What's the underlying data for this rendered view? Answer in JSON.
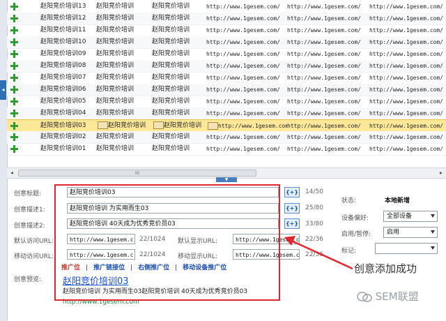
{
  "grid": {
    "rows": [
      {
        "name": "赵阳竞价培训13",
        "c2": "赵阳竞价培训",
        "c3": "赵阳竞价培训",
        "u1": "http://www.1gesem.com/",
        "u2": "http://www.1gesem.com/",
        "u3": "http://www.1gesem.com/"
      },
      {
        "name": "赵阳竞价培训12",
        "c2": "赵阳竞价培训",
        "c3": "赵阳竞价培训",
        "u1": "http://www.1gesem.com/",
        "u2": "http://www.1gesem.com/",
        "u3": "http://www.1gesem.com/"
      },
      {
        "name": "赵阳竞价培训11",
        "c2": "赵阳竞价培训",
        "c3": "赵阳竞价培训",
        "u1": "http://www.1gesem.com/",
        "u2": "http://www.1gesem.com/",
        "u3": "http://www.1gesem.com/"
      },
      {
        "name": "赵阳竞价培训10",
        "c2": "赵阳竞价培训",
        "c3": "赵阳竞价培训",
        "u1": "http://www.1gesem.com/",
        "u2": "http://www.1gesem.com/",
        "u3": "http://www.1gesem.com/"
      },
      {
        "name": "赵阳竞价培训09",
        "c2": "赵阳竞价培训",
        "c3": "赵阳竞价培训",
        "u1": "http://www.1gesem.com/",
        "u2": "http://www.1gesem.com/",
        "u3": "http://www.1gesem.com/"
      },
      {
        "name": "赵阳竞价培训08",
        "c2": "赵阳竞价培训",
        "c3": "赵阳竞价培训",
        "u1": "http://www.1gesem.com/",
        "u2": "http://www.1gesem.com/",
        "u3": "http://www.1gesem.com/"
      },
      {
        "name": "赵阳竞价培训07",
        "c2": "赵阳竞价培训",
        "c3": "赵阳竞价培训",
        "u1": "http://www.1gesem.com/",
        "u2": "http://www.1gesem.com/",
        "u3": "http://www.1gesem.com/"
      },
      {
        "name": "赵阳竞价培训06",
        "c2": "赵阳竞价培训",
        "c3": "赵阳竞价培训",
        "u1": "http://www.1gesem.com/",
        "u2": "http://www.1gesem.com/",
        "u3": "http://www.1gesem.com/"
      },
      {
        "name": "赵阳竞价培训05",
        "c2": "赵阳竞价培训",
        "c3": "赵阳竞价培训",
        "u1": "http://www.1gesem.com/",
        "u2": "http://www.1gesem.com/",
        "u3": "http://www.1gesem.com/"
      },
      {
        "name": "赵阳竞价培训04",
        "c2": "赵阳竞价培训",
        "c3": "赵阳竞价培训",
        "u1": "http://www.1gesem.com/",
        "u2": "http://www.1gesem.com/",
        "u3": "http://www.1gesem.com/"
      },
      {
        "name": "赵阳竞价培训03",
        "c2": "赵阳竞价培训",
        "c3": "赵阳竞价培训",
        "u1": "http://www.1gesem.com/",
        "u2": "http://www.1gesem.com/",
        "u3": "http://www.1gesem.com/"
      },
      {
        "name": "赵阳竞价培训02",
        "c2": "赵阳竞价培训",
        "c3": "赵阳竞价培训",
        "u1": "http://www.1gesem.com/",
        "u2": "http://www.1gesem.com/",
        "u3": "http://www.1gesem.com/"
      },
      {
        "name": "赵阳竞价培训01",
        "c2": "赵阳竞价培训",
        "c3": "赵阳竞价培训",
        "u1": "http://www.1gesem.com/",
        "u2": "http://www.1gesem.com/",
        "u3": "http://www.1gesem.com/"
      }
    ],
    "selected_index": 10,
    "scroll_thumb_label": "III"
  },
  "editor": {
    "title_label": "创意标题:",
    "title_value": "赵阳竞价培训03",
    "title_count": "14/50",
    "desc1_label": "创意描述1:",
    "desc1_value": "赵阳竞价培训 为实用而生03",
    "desc1_count": "25/80",
    "desc2_label": "创意描述2:",
    "desc2_value": "赵阳竞价培训 40天成为优秀竞价员03",
    "desc2_count": "33/80",
    "insert_label": "{+}",
    "pc_url_label": "默认访问URL:",
    "pc_url_value": "http://www.1gesem.c",
    "pc_url_count": "22/1024",
    "pc_display_label": "默认显示URL:",
    "pc_display_value": "http://www.1gesem.c",
    "pc_display_count": "22/36",
    "mobile_url_label": "移动访问URL:",
    "mobile_url_value": "http://www.1gesem.c",
    "mobile_url_count": "22/1024",
    "mobile_display_label": "移动显示URL:",
    "mobile_display_value": "http://www.1gesem.c",
    "mobile_display_count": "22/36",
    "tabs": [
      "推广位",
      "推广链接位",
      "右侧推广位",
      "移动设备推广位"
    ],
    "preview_label": "创意预览:",
    "preview_title": "赵阳竞价培训03",
    "preview_desc": "赵阳竞价培训 为实用而生03赵阳竞价培训 40天成为优秀竞价员03",
    "preview_url": "http://www.1gesem.com"
  },
  "side": {
    "status_label": "状态:",
    "status_value": "本地新增",
    "device_label": "设备偏好:",
    "device_value": "全部设备",
    "enable_label": "启用/暂停:",
    "enable_value": "启用",
    "tag_label": "标记:",
    "tag_value": ""
  },
  "annotation": {
    "success_text": "创意添加成功",
    "watermark": "SEM联盟"
  },
  "colors": {
    "highlight_row": "#fde89a",
    "annotation_red": "#e1262d",
    "link_blue": "#1a4fd0",
    "plus_green": "#2e9b2e"
  }
}
